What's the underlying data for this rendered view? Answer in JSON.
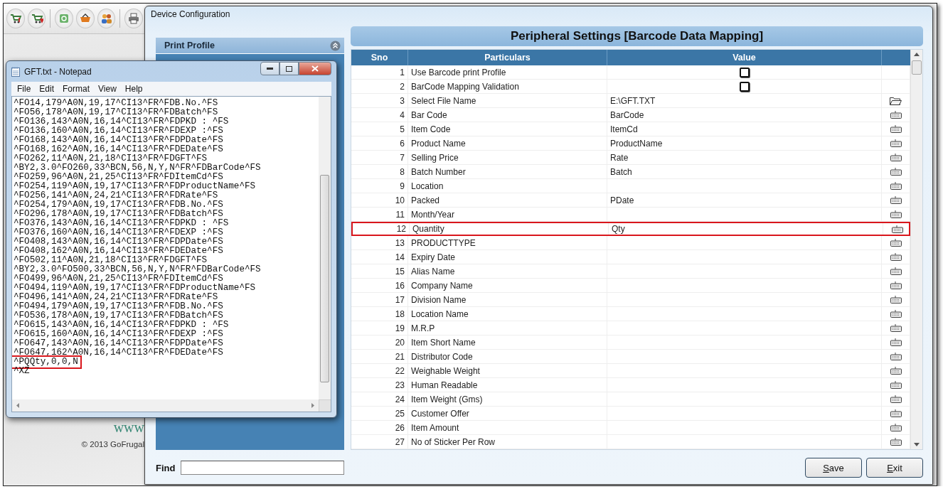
{
  "background_app": {
    "toolbar": [
      {
        "kind": "cart-in"
      },
      {
        "kind": "cart-out"
      },
      {
        "kind": "separator"
      },
      {
        "kind": "money"
      },
      {
        "kind": "basket"
      },
      {
        "kind": "people"
      },
      {
        "kind": "separator"
      },
      {
        "kind": "printer"
      }
    ],
    "website": "www",
    "copyright": "© 2013  GoFrugal"
  },
  "device_window": {
    "title": "Device Configuration",
    "sidebar": {
      "header": "Print Profile"
    },
    "find": {
      "label": "Find"
    },
    "panel_title": "Peripheral Settings [Barcode Data Mapping]",
    "table": {
      "columns": [
        "Sno",
        "Particulars",
        "Value"
      ],
      "rows": [
        {
          "sno": "1",
          "particular": "Use Barcode print Profile",
          "kind": "checkbox",
          "checked": false,
          "highlighted": false
        },
        {
          "sno": "2",
          "particular": "BarCode Mapping Validation",
          "kind": "checkbox",
          "checked": false,
          "highlighted": false
        },
        {
          "sno": "3",
          "particular": "Select File Name",
          "value": "E:\\GFT.TXT",
          "kind": "file",
          "highlighted": false
        },
        {
          "sno": "4",
          "particular": "Bar Code",
          "value": "BarCode",
          "kind": "text",
          "highlighted": false
        },
        {
          "sno": "5",
          "particular": "Item Code",
          "value": "ItemCd",
          "kind": "text",
          "highlighted": false
        },
        {
          "sno": "6",
          "particular": "Product Name",
          "value": "ProductName",
          "kind": "text",
          "highlighted": false
        },
        {
          "sno": "7",
          "particular": "Selling Price",
          "value": "Rate",
          "kind": "text",
          "highlighted": false
        },
        {
          "sno": "8",
          "particular": "Batch Number",
          "value": "Batch",
          "kind": "text",
          "highlighted": false
        },
        {
          "sno": "9",
          "particular": "Location",
          "kind": "text",
          "highlighted": false
        },
        {
          "sno": "10",
          "particular": "Packed",
          "value": "PDate",
          "kind": "text",
          "highlighted": false
        },
        {
          "sno": "11",
          "particular": "Month/Year",
          "kind": "text",
          "highlighted": false
        },
        {
          "sno": "12",
          "particular": "Quantity",
          "value": "Qty",
          "kind": "text",
          "highlighted": true
        },
        {
          "sno": "13",
          "particular": "PRODUCTTYPE",
          "kind": "text",
          "highlighted": false
        },
        {
          "sno": "14",
          "particular": "Expiry Date",
          "kind": "text",
          "highlighted": false
        },
        {
          "sno": "15",
          "particular": "Alias Name",
          "kind": "text",
          "highlighted": false
        },
        {
          "sno": "16",
          "particular": "Company Name",
          "kind": "text",
          "highlighted": false
        },
        {
          "sno": "17",
          "particular": "Division Name",
          "kind": "text",
          "highlighted": false
        },
        {
          "sno": "18",
          "particular": "Location Name",
          "kind": "text",
          "highlighted": false
        },
        {
          "sno": "19",
          "particular": "M.R.P",
          "kind": "text",
          "highlighted": false
        },
        {
          "sno": "20",
          "particular": "Item Short Name",
          "kind": "text",
          "highlighted": false
        },
        {
          "sno": "21",
          "particular": "Distributor Code",
          "kind": "text",
          "highlighted": false
        },
        {
          "sno": "22",
          "particular": "Weighable Weight",
          "kind": "text",
          "highlighted": false
        },
        {
          "sno": "23",
          "particular": "Human Readable",
          "kind": "text",
          "highlighted": false
        },
        {
          "sno": "24",
          "particular": "Item Weight (Gms)",
          "kind": "text",
          "highlighted": false
        },
        {
          "sno": "25",
          "particular": "Customer Offer",
          "kind": "text",
          "highlighted": false
        },
        {
          "sno": "26",
          "particular": "Item Amount",
          "kind": "text",
          "highlighted": false
        },
        {
          "sno": "27",
          "particular": "No of Sticker Per Row",
          "kind": "text",
          "highlighted": false
        }
      ]
    },
    "buttons": [
      "Save",
      "Exit"
    ]
  },
  "notepad": {
    "title": "GFT.txt - Notepad",
    "menu": [
      "File",
      "Edit",
      "Format",
      "View",
      "Help"
    ],
    "lines": [
      {
        "text": "^FO14,179^A0N,19,17^CI13^FR^FDB.No.^FS",
        "highlighted": false
      },
      {
        "text": "^FO56,178^A0N,19,17^CI13^FR^FDBatch^FS",
        "highlighted": false
      },
      {
        "text": "^FO136,143^A0N,16,14^CI13^FR^FDPKD : ^FS",
        "highlighted": false
      },
      {
        "text": "^FO136,160^A0N,16,14^CI13^FR^FDEXP :^FS",
        "highlighted": false
      },
      {
        "text": "^FO168,143^A0N,16,14^CI13^FR^FDPDate^FS",
        "highlighted": false
      },
      {
        "text": "^FO168,162^A0N,16,14^CI13^FR^FDEDate^FS",
        "highlighted": false
      },
      {
        "text": "^FO262,11^A0N,21,18^CI13^FR^FDGFT^FS",
        "highlighted": false
      },
      {
        "text": "^BY2,3.0^FO260,33^BCN,56,N,Y,N^FR^FDBarCode^FS",
        "highlighted": false
      },
      {
        "text": "^FO259,96^A0N,21,25^CI13^FR^FDItemCd^FS",
        "highlighted": false
      },
      {
        "text": "^FO254,119^A0N,19,17^CI13^FR^FDProductName^FS",
        "highlighted": false
      },
      {
        "text": "^FO256,141^A0N,24,21^CI13^FR^FDRate^FS",
        "highlighted": false
      },
      {
        "text": "^FO254,179^A0N,19,17^CI13^FR^FDB.No.^FS",
        "highlighted": false
      },
      {
        "text": "^FO296,178^A0N,19,17^CI13^FR^FDBatch^FS",
        "highlighted": false
      },
      {
        "text": "^FO376,143^A0N,16,14^CI13^FR^FDPKD : ^FS",
        "highlighted": false
      },
      {
        "text": "^FO376,160^A0N,16,14^CI13^FR^FDEXP :^FS",
        "highlighted": false
      },
      {
        "text": "^FO408,143^A0N,16,14^CI13^FR^FDPDate^FS",
        "highlighted": false
      },
      {
        "text": "^FO408,162^A0N,16,14^CI13^FR^FDEDate^FS",
        "highlighted": false
      },
      {
        "text": "^FO502,11^A0N,21,18^CI13^FR^FDGFT^FS",
        "highlighted": false
      },
      {
        "text": "^BY2,3.0^FO500,33^BCN,56,N,Y,N^FR^FDBarCode^FS",
        "highlighted": false
      },
      {
        "text": "^FO499,96^A0N,21,25^CI13^FR^FDItemCd^FS",
        "highlighted": false
      },
      {
        "text": "^FO494,119^A0N,19,17^CI13^FR^FDProductName^FS",
        "highlighted": false
      },
      {
        "text": "^FO496,141^A0N,24,21^CI13^FR^FDRate^FS",
        "highlighted": false
      },
      {
        "text": "^FO494,179^A0N,19,17^CI13^FR^FDB.No.^FS",
        "highlighted": false
      },
      {
        "text": "^FO536,178^A0N,19,17^CI13^FR^FDBatch^FS",
        "highlighted": false
      },
      {
        "text": "^FO615,143^A0N,16,14^CI13^FR^FDPKD : ^FS",
        "highlighted": false
      },
      {
        "text": "^FO615,160^A0N,16,14^CI13^FR^FDEXP :^FS",
        "highlighted": false
      },
      {
        "text": "^FO647,143^A0N,16,14^CI13^FR^FDPDate^FS",
        "highlighted": false
      },
      {
        "text": "^FO647,162^A0N,16,14^CI13^FR^FDEDate^FS",
        "highlighted": false
      },
      {
        "text": "^PQQty,0,0,N",
        "highlighted": true
      },
      {
        "text": "^XZ",
        "highlighted": false
      }
    ]
  }
}
